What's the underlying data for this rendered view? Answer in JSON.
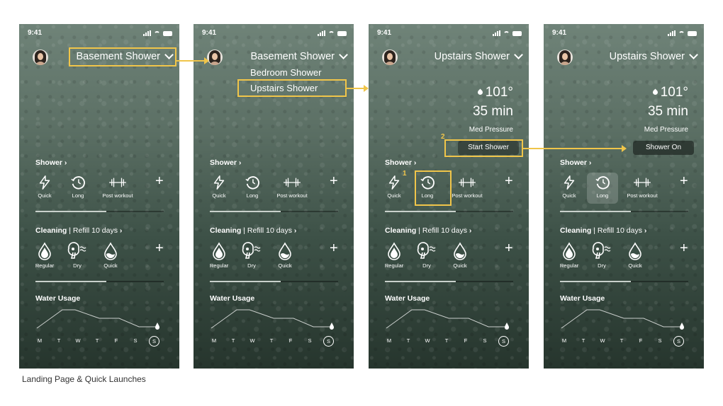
{
  "caption": "Landing Page & Quick Launches",
  "colors": {
    "highlight": "#f0c54a",
    "background_top": "#6f8378",
    "background_bottom": "#26352d"
  },
  "screens": [
    {
      "time": "9:41",
      "title": "Basement Shower",
      "shower": {
        "title": "Shower",
        "items": [
          "Quick",
          "Long",
          "Post workout"
        ]
      },
      "cleaning": {
        "title": "Cleaning",
        "refill": "Refill 10 days",
        "items": [
          "Regular",
          "Dry",
          "Quick"
        ]
      },
      "water_usage": {
        "title": "Water Usage",
        "days": [
          "M",
          "T",
          "W",
          "T",
          "F",
          "S",
          "S"
        ]
      }
    },
    {
      "time": "9:41",
      "title": "Basement Shower",
      "dropdown": [
        "Bedroom Shower",
        "Upstairs Shower"
      ],
      "shower": {
        "title": "Shower",
        "items": [
          "Quick",
          "Long",
          "Post workout"
        ]
      },
      "cleaning": {
        "title": "Cleaning",
        "refill": "Refill 10 days",
        "items": [
          "Regular",
          "Dry",
          "Quick"
        ]
      },
      "water_usage": {
        "title": "Water Usage",
        "days": [
          "M",
          "T",
          "W",
          "T",
          "F",
          "S",
          "S"
        ]
      }
    },
    {
      "time": "9:41",
      "title": "Upstairs Shower",
      "temperature": "101°",
      "duration": "35 min",
      "pressure": "Med Pressure",
      "action": "Start Shower",
      "markers": [
        "1",
        "2"
      ],
      "shower": {
        "title": "Shower",
        "items": [
          "Quick",
          "Long",
          "Post workout"
        ]
      },
      "cleaning": {
        "title": "Cleaning",
        "refill": "Refill 10 days",
        "items": [
          "Regular",
          "Dry",
          "Quick"
        ]
      },
      "water_usage": {
        "title": "Water Usage",
        "days": [
          "M",
          "T",
          "W",
          "T",
          "F",
          "S",
          "S"
        ]
      }
    },
    {
      "time": "9:41",
      "title": "Upstairs Shower",
      "temperature": "101°",
      "duration": "35 min",
      "pressure": "Med Pressure",
      "action": "Shower On",
      "shower": {
        "title": "Shower",
        "items": [
          "Quick",
          "Long",
          "Post workout"
        ]
      },
      "cleaning": {
        "title": "Cleaning",
        "refill": "Refill 10 days",
        "items": [
          "Regular",
          "Dry",
          "Quick"
        ]
      },
      "water_usage": {
        "title": "Water Usage",
        "days": [
          "M",
          "T",
          "W",
          "T",
          "F",
          "S",
          "S"
        ]
      }
    }
  ]
}
